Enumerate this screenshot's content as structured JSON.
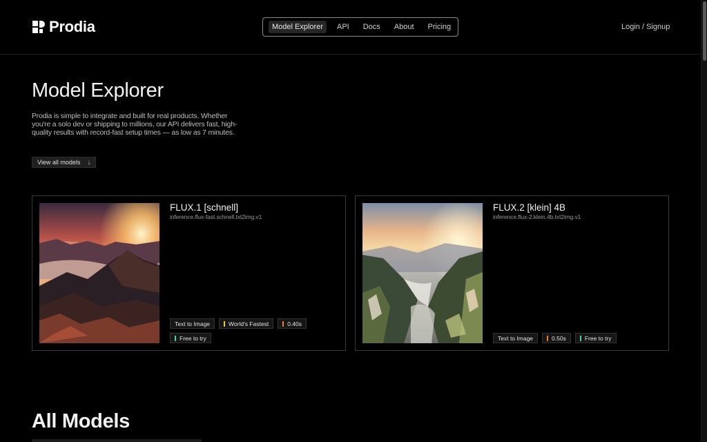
{
  "brand": {
    "name": "Prodia"
  },
  "nav": {
    "items": [
      {
        "label": "Model Explorer",
        "active": true
      },
      {
        "label": "API",
        "active": false
      },
      {
        "label": "Docs",
        "active": false
      },
      {
        "label": "About",
        "active": false
      },
      {
        "label": "Pricing",
        "active": false
      }
    ]
  },
  "auth": {
    "label": "Login / Signup"
  },
  "hero": {
    "title": "Model Explorer",
    "description": "Prodia is simple to integrate and built for real products. Whether you're a solo dev or shipping to millions, our API delivers fast, high-quality results with record-fast setup times — as low as 7 minutes.",
    "view_all_label": "View all models"
  },
  "cards": [
    {
      "name": "FLUX.1 [schnell]",
      "id": "inference.flux-fast.schnell.txt2img.v1",
      "tags": [
        {
          "label": "Text to Image",
          "color": ""
        },
        {
          "label": "World's Fastest",
          "color": "#f5c518"
        },
        {
          "label": "0.40s",
          "color": "#f07a2a"
        },
        {
          "label": "Free to try",
          "color": "#3fd3a8"
        }
      ]
    },
    {
      "name": "FLUX.2 [klein] 4B",
      "id": "inference.flux-2.klein.4b.txt2img.v1",
      "tags": [
        {
          "label": "Text to Image",
          "color": ""
        },
        {
          "label": "0.50s",
          "color": "#f07a2a"
        },
        {
          "label": "Free to try",
          "color": "#3fd3a8"
        }
      ]
    }
  ],
  "all_models": {
    "title": "All Models"
  }
}
